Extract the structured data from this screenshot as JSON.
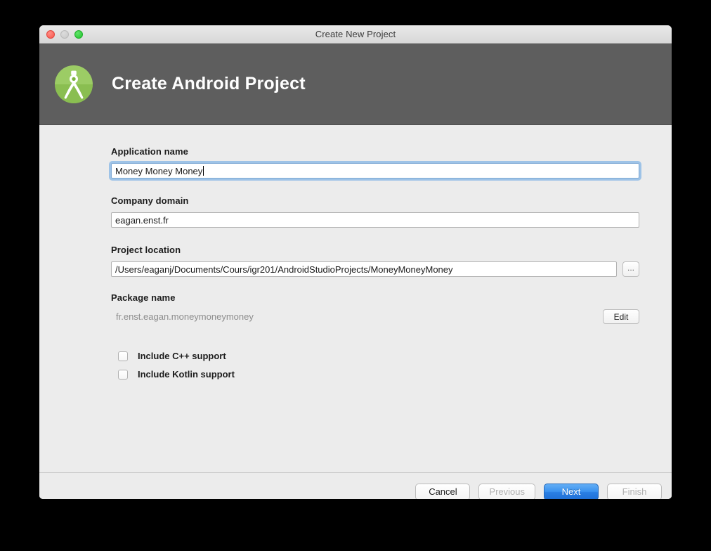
{
  "window": {
    "title": "Create New Project",
    "traffic_lights": [
      "close-button",
      "minimize-button",
      "zoom-button"
    ]
  },
  "header": {
    "title": "Create Android Project",
    "logo_name": "android-studio-logo",
    "background": "#5e5e5e"
  },
  "form": {
    "application_name": {
      "label": "Application name",
      "value": "Money Money Money",
      "focused": true
    },
    "company_domain": {
      "label": "Company domain",
      "value": "eagan.enst.fr",
      "focused": false
    },
    "project_location": {
      "label": "Project location",
      "value": "/Users/eaganj/Documents/Cours/igr201/AndroidStudioProjects/MoneyMoneyMoney",
      "browse_label": "..."
    },
    "package_name": {
      "label": "Package name",
      "value": "fr.enst.eagan.moneymoneymoney",
      "edit_label": "Edit",
      "readonly": true
    },
    "checkboxes": [
      {
        "label": "Include C++ support",
        "checked": false
      },
      {
        "label": "Include Kotlin support",
        "checked": false
      }
    ]
  },
  "footer": {
    "buttons": [
      {
        "label": "Cancel",
        "state": "enabled"
      },
      {
        "label": "Previous",
        "state": "disabled"
      },
      {
        "label": "Next",
        "state": "default"
      },
      {
        "label": "Finish",
        "state": "disabled"
      }
    ]
  },
  "colors": {
    "accent": "#3a91ef",
    "header_bg": "#5e5e5e",
    "body_bg": "#ececec",
    "logo_green": "#8bc34a",
    "focus_ring": "#6eaae4"
  }
}
